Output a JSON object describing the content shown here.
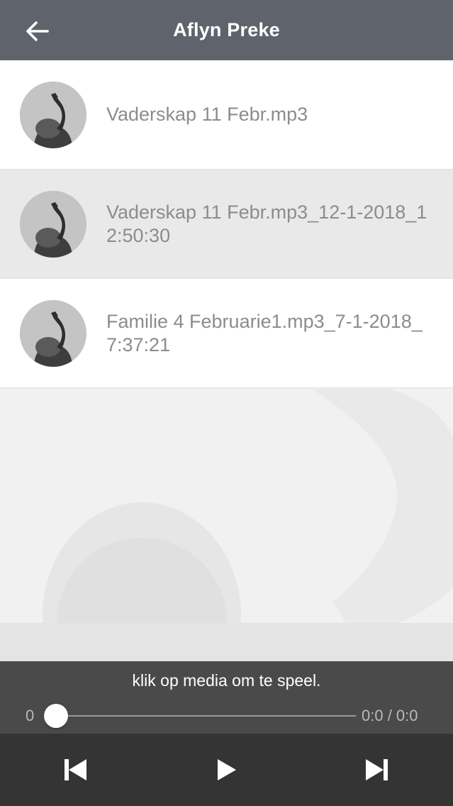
{
  "header": {
    "title": "Aflyn Preke",
    "back_icon": "arrow-left-icon"
  },
  "recordings": [
    {
      "label": "Vaderskap 11 Febr.mp3",
      "selected": false
    },
    {
      "label": "Vaderskap 11 Febr.mp3_12-1-2018_12:50:30",
      "selected": true
    },
    {
      "label": "Familie 4 Februarie1.mp3_7-1-2018_7:37:21",
      "selected": false
    }
  ],
  "player": {
    "hint": "klik op media om te speel.",
    "position": "0",
    "time_display": "0:0 / 0:0",
    "progress": 0
  },
  "controls": {
    "previous_icon": "skip-previous-icon",
    "play_icon": "play-icon",
    "next_icon": "skip-next-icon"
  },
  "colors": {
    "header": "#5f646c",
    "player_info": "#4a4a4a",
    "controls": "#343434",
    "selected_row": "#e9e9e9"
  }
}
